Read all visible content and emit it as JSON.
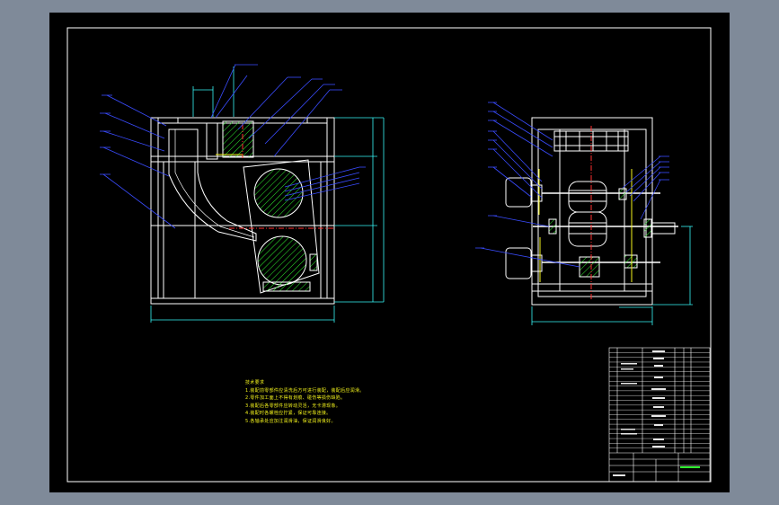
{
  "drawing": {
    "background": "#000000",
    "outer_background": "#7f8a99",
    "line_color": "#ffffff",
    "dimension_color": "#37f7f7",
    "leader_color": "#3a4cff",
    "hatch_color": "#2ff22f",
    "center_line_color": "#ff3030",
    "accent_color": "#f5f51d"
  },
  "technical_notes": {
    "title": "技术要求",
    "items": [
      "1.装配前零部件应清洗后方可进行装配，装配后应润滑。",
      "2.零件加工面上不得有划痕、碰伤等损伤缺陷。",
      "3.装配后各零部件应转动灵活，无卡滞现象。",
      "4.装配时各螺栓应拧紧，保证可靠连接。",
      "5.各轴承处应加注润滑油，保证润滑良好。"
    ]
  },
  "title_block": {
    "rows_left": [
      "1",
      "2",
      "3",
      "4",
      "5",
      "6",
      "7",
      "8",
      "9",
      "10",
      "11",
      "12",
      "13",
      "14",
      "15",
      "16",
      "17",
      "18",
      "19",
      "20",
      "21",
      "22"
    ],
    "label_bottom_green": "",
    "label_bottom": ""
  }
}
